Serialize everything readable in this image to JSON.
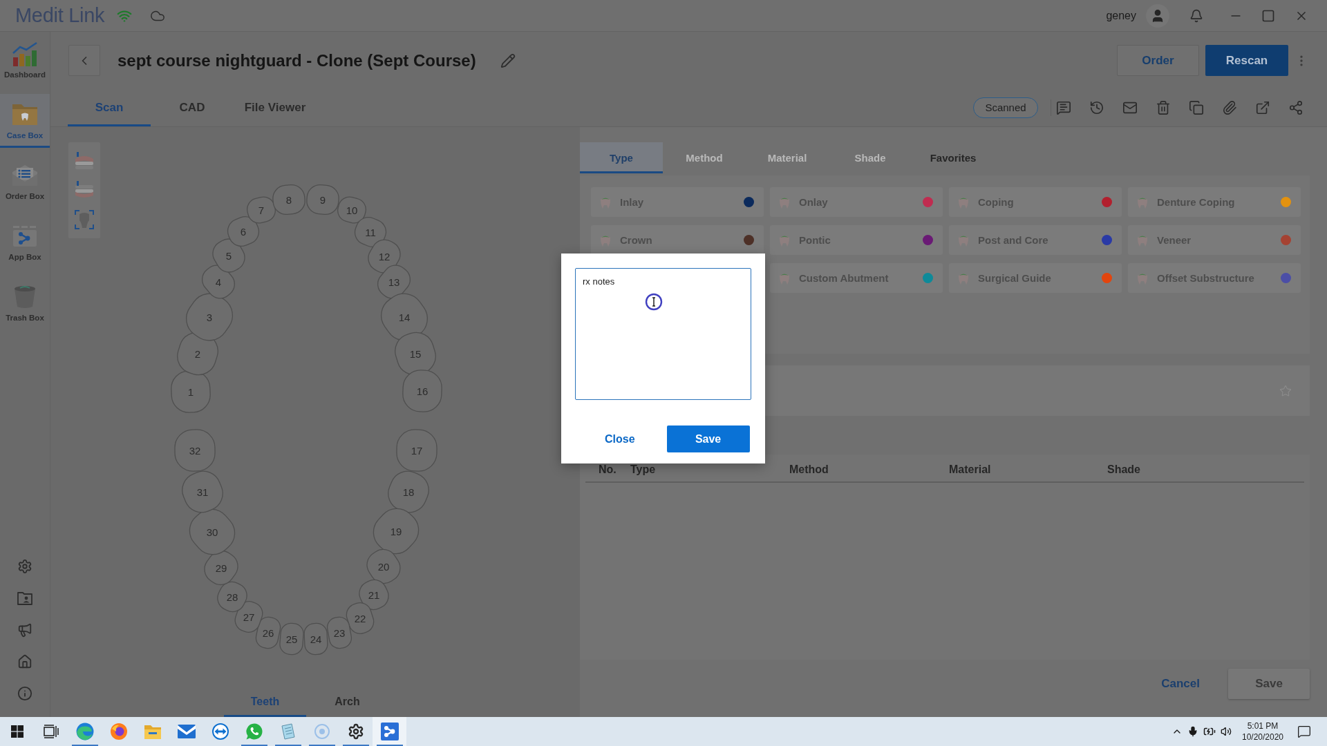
{
  "title_bar": {
    "app_name": "Medit Link",
    "user": "geney"
  },
  "sidebar": {
    "items": [
      {
        "label": "Dashboard",
        "selected": false
      },
      {
        "label": "Case Box",
        "selected": true
      },
      {
        "label": "Order Box",
        "selected": false
      },
      {
        "label": "App Box",
        "selected": false
      },
      {
        "label": "Trash Box",
        "selected": false
      }
    ]
  },
  "case": {
    "title": "sept course nightguard - Clone (Sept Course)",
    "actions": [
      {
        "label": "Order",
        "kind": "outline"
      },
      {
        "label": "Rescan",
        "kind": "primary"
      }
    ],
    "tabs": [
      {
        "label": "Scan",
        "selected": true
      },
      {
        "label": "CAD",
        "selected": false
      },
      {
        "label": "File Viewer",
        "selected": false
      }
    ],
    "status": "Scanned"
  },
  "tooth_chart": {
    "upper_teeth": [
      "1",
      "2",
      "3",
      "4",
      "5",
      "6",
      "7",
      "8",
      "9",
      "10",
      "11",
      "12",
      "13",
      "14",
      "15",
      "16"
    ],
    "lower_teeth": [
      "17",
      "18",
      "19",
      "20",
      "21",
      "22",
      "23",
      "24",
      "25",
      "26",
      "27",
      "28",
      "29",
      "30",
      "31",
      "32"
    ],
    "tabs": [
      {
        "label": "Teeth",
        "selected": true
      },
      {
        "label": "Arch",
        "selected": false
      }
    ]
  },
  "prosthesis": {
    "tabs": [
      {
        "label": "Type",
        "selected": true,
        "disabled": false
      },
      {
        "label": "Method",
        "selected": false,
        "disabled": true
      },
      {
        "label": "Material",
        "selected": false,
        "disabled": true
      },
      {
        "label": "Shade",
        "selected": false,
        "disabled": true
      },
      {
        "label": "Favorites",
        "selected": false,
        "disabled": false
      }
    ],
    "type_rows": [
      {
        "cards": [
          {
            "label": "Inlay",
            "color": "#0b2a5c"
          },
          {
            "label": "Onlay",
            "color": "#c02c50"
          },
          {
            "label": "Coping",
            "color": "#b2202e"
          },
          {
            "label": "Denture Coping",
            "color": "#e3920f"
          }
        ]
      },
      {
        "cards": [
          {
            "label": "Crown",
            "color": "#4d3027"
          },
          {
            "label": "Pontic",
            "color": "#6a1a75"
          },
          {
            "label": "Post and Core",
            "color": "#2a3aa6"
          },
          {
            "label": "Veneer",
            "color": "#a54232"
          }
        ]
      },
      {
        "cards": [
          {
            "label": "Custom Abutment",
            "color": "#0e8a99"
          },
          {
            "label": "Surgical Guide",
            "color": "#e2450e"
          },
          {
            "label": "Offset Substructure",
            "color": "#4b4ea6"
          }
        ]
      }
    ],
    "table": {
      "columns": [
        "No.",
        "Type",
        "Method",
        "Material",
        "Shade"
      ]
    },
    "footer": {
      "actions": [
        {
          "label": "Cancel",
          "kind": "link",
          "disabled": false
        },
        {
          "label": "Save",
          "kind": "button",
          "disabled": true
        }
      ]
    }
  },
  "notes_dialog": {
    "notes": {
      "value": "rx notes"
    },
    "actions": [
      {
        "label": "Close",
        "kind": "link"
      },
      {
        "label": "Save",
        "kind": "primary"
      }
    ]
  },
  "taskbar": {
    "apps": [
      {
        "open": true,
        "selected": false
      },
      {
        "open": false,
        "selected": false
      },
      {
        "open": false,
        "selected": false
      },
      {
        "open": false,
        "selected": false
      },
      {
        "open": false,
        "selected": false
      },
      {
        "open": true,
        "selected": false
      },
      {
        "open": true,
        "selected": false
      },
      {
        "open": true,
        "selected": false
      },
      {
        "open": true,
        "selected": false
      },
      {
        "open": true,
        "selected": true
      }
    ],
    "time": "5:01 PM",
    "date": "10/20/2020"
  }
}
